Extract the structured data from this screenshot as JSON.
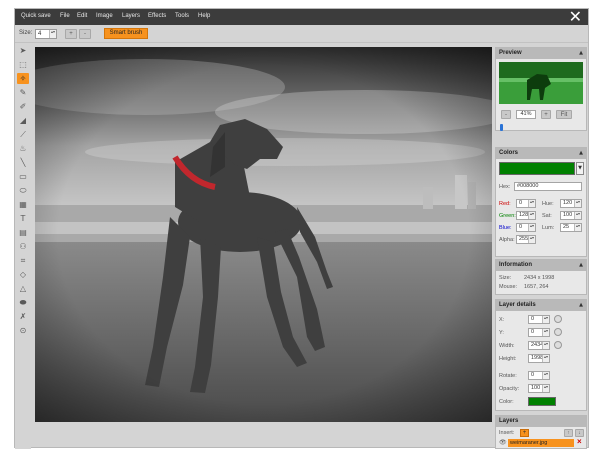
{
  "menu": {
    "items": [
      "Quick save",
      "File",
      "Edit",
      "Image",
      "Layers",
      "Effects",
      "Tools",
      "Help"
    ]
  },
  "options": {
    "size_label": "Size:",
    "size_value": "4",
    "plus": "+",
    "minus": "-",
    "smart_brush_label": "Smart brush"
  },
  "tools": [
    "pointer-tool",
    "select-tool",
    "magic-wand-tool",
    "brush-tool",
    "pencil-tool",
    "eraser-tool",
    "pick-color-tool",
    "fill-tool",
    "line-tool",
    "rectangle-tool",
    "ellipse-tool",
    "image-tool",
    "text-tool",
    "gradient-tool",
    "clone-tool",
    "crop-tool",
    "blur-tool",
    "sharpen-tool",
    "shape-tool",
    "erase-tool",
    "play-tool"
  ],
  "preview": {
    "title": "Preview",
    "zoom": "41%",
    "minus": "-",
    "plus": "+",
    "fit": "Fit"
  },
  "colors": {
    "title": "Colors",
    "swatch": "#008000",
    "hex_label": "Hex:",
    "hex_value": "#008000",
    "red_label": "Red:",
    "red_value": "0",
    "green_label": "Green:",
    "green_value": "128",
    "blue_label": "Blue:",
    "blue_value": "0",
    "alpha_label": "Alpha:",
    "alpha_value": "255",
    "hue_label": "Hue:",
    "hue_value": "120",
    "sat_label": "Sat:",
    "sat_value": "100",
    "lum_label": "Lum:",
    "lum_value": "25"
  },
  "information": {
    "title": "Information",
    "size_label": "Size:",
    "size_value": "2434 x 1998",
    "mouse_label": "Mouse:",
    "mouse_value": "1657, 264"
  },
  "layer_details": {
    "title": "Layer details",
    "x_label": "X:",
    "x_value": "0",
    "y_label": "Y:",
    "y_value": "0",
    "width_label": "Width:",
    "width_value": "2434",
    "height_label": "Height:",
    "height_value": "1998",
    "rotate_label": "Rotate:",
    "rotate_value": "0",
    "opacity_label": "Opacity:",
    "opacity_value": "100",
    "color_label": "Color:",
    "color_swatch": "#008000"
  },
  "layers": {
    "title": "Layers",
    "insert_label": "Insert:",
    "insert_btn": "+",
    "up": "↑",
    "down": "↓",
    "layer_name": "weimaraner.jpg",
    "delete": "×"
  },
  "colors_palette": {
    "accent": "#f7921e",
    "menubar": "#3c3c3c",
    "red_text": "#cc0000",
    "green_text": "#008000",
    "blue_text": "#0000cc"
  }
}
